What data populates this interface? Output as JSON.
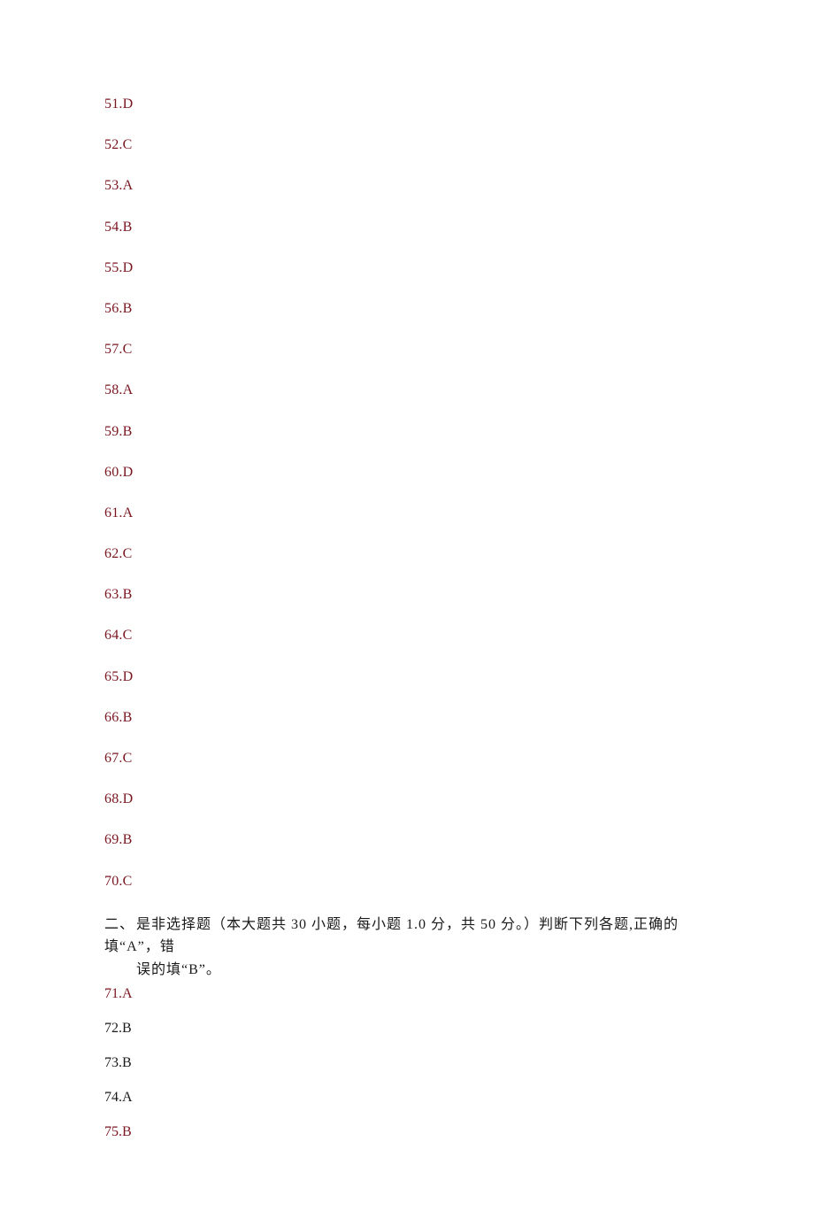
{
  "answers_block1": [
    "51.D",
    "52.C",
    "53.A",
    "54.B",
    "55.D",
    "56.B",
    "57.C",
    "58.A",
    "59.B",
    "60.D",
    "61.A",
    "62.C",
    "63.B",
    "64.C",
    "65.D",
    "66.B",
    "67.C",
    "68.D",
    "69.B",
    "70.C"
  ],
  "section": {
    "numeral": "二、",
    "line1": "是非选择题（本大题共 30 小题，每小题 1.0 分，共 50 分。）判断下列各题,正确的填“A”，错",
    "line2": "误的填“B”。"
  },
  "answers_block2": [
    {
      "text": "71.A",
      "color": "red"
    },
    {
      "text": "72.B",
      "color": "black"
    },
    {
      "text": "73.B",
      "color": "black"
    },
    {
      "text": "74.A",
      "color": "black"
    },
    {
      "text": "75.B",
      "color": "red"
    }
  ]
}
